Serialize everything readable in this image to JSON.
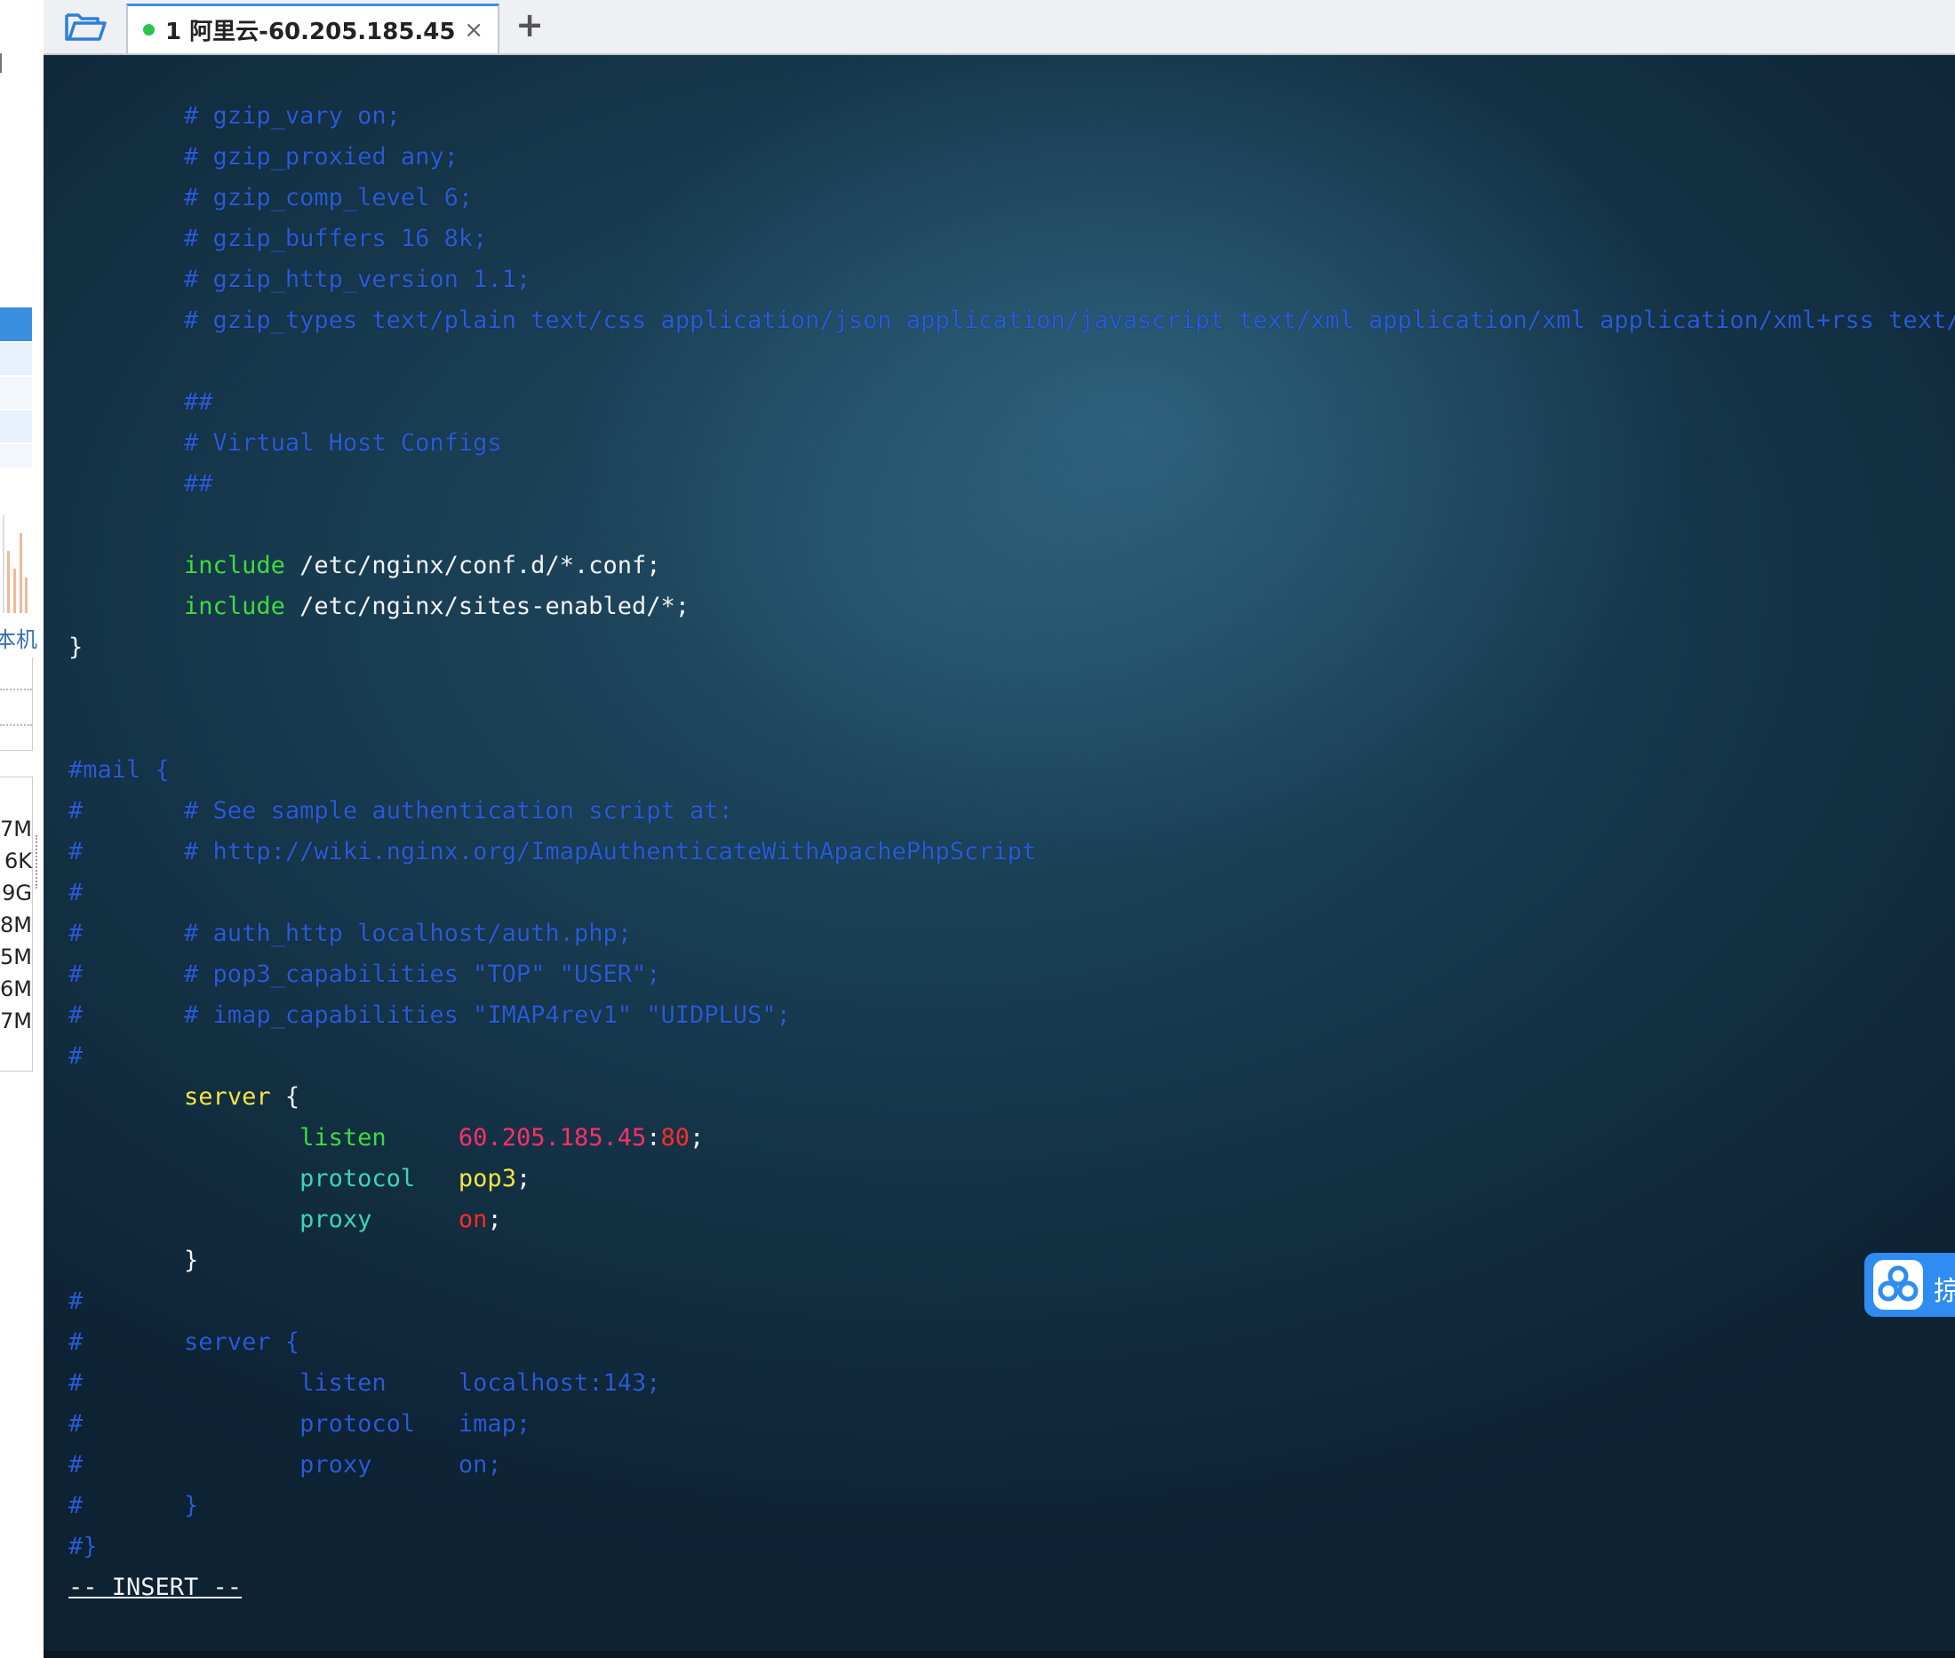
{
  "left_panel": {
    "label": "本机",
    "sizes": [
      "7M",
      "6K",
      "9G",
      "8M",
      "5M",
      "6M",
      "7M"
    ]
  },
  "tabbar": {
    "folder_icon": "folder-open-icon",
    "tab_number": "1",
    "tab_title": "阿里云-60.205.185.45",
    "close_glyph": "×",
    "new_tab_glyph": "+"
  },
  "terminal": {
    "lines": [
      {
        "segments": [
          {
            "text": "        # gzip_vary on;",
            "cls": "c-comment"
          }
        ]
      },
      {
        "segments": [
          {
            "text": "        # gzip_proxied any;",
            "cls": "c-comment"
          }
        ]
      },
      {
        "segments": [
          {
            "text": "        # gzip_comp_level 6;",
            "cls": "c-comment"
          }
        ]
      },
      {
        "segments": [
          {
            "text": "        # gzip_buffers 16 8k;",
            "cls": "c-comment"
          }
        ]
      },
      {
        "segments": [
          {
            "text": "        # gzip_http_version 1.1;",
            "cls": "c-comment"
          }
        ]
      },
      {
        "segments": [
          {
            "text": "        # gzip_types text/plain text/css application/json application/javascript text/xml application/xml application/xml+rss text/javascript;",
            "cls": "c-comment"
          }
        ]
      },
      {
        "segments": []
      },
      {
        "segments": [
          {
            "text": "        ##",
            "cls": "c-comment"
          }
        ]
      },
      {
        "segments": [
          {
            "text": "        # Virtual Host Configs",
            "cls": "c-comment"
          }
        ]
      },
      {
        "segments": [
          {
            "text": "        ##",
            "cls": "c-comment"
          }
        ]
      },
      {
        "segments": []
      },
      {
        "segments": [
          {
            "text": "        ",
            "cls": "c-white"
          },
          {
            "text": "include",
            "cls": "c-green"
          },
          {
            "text": " /etc/nginx/conf.d/*.conf;",
            "cls": "c-white"
          }
        ]
      },
      {
        "segments": [
          {
            "text": "        ",
            "cls": "c-white"
          },
          {
            "text": "include",
            "cls": "c-green"
          },
          {
            "text": " /etc/nginx/sites-enabled/*;",
            "cls": "c-white"
          }
        ]
      },
      {
        "segments": [
          {
            "text": "}",
            "cls": "c-white"
          }
        ]
      },
      {
        "segments": []
      },
      {
        "segments": []
      },
      {
        "segments": [
          {
            "text": "#mail {",
            "cls": "c-comment"
          }
        ]
      },
      {
        "segments": [
          {
            "text": "#       # See sample authentication script at:",
            "cls": "c-comment"
          }
        ]
      },
      {
        "segments": [
          {
            "text": "#       # http://wiki.nginx.org/ImapAuthenticateWithApachePhpScript",
            "cls": "c-comment"
          }
        ]
      },
      {
        "segments": [
          {
            "text": "#",
            "cls": "c-comment"
          }
        ]
      },
      {
        "segments": [
          {
            "text": "#       # auth_http localhost/auth.php;",
            "cls": "c-comment"
          }
        ]
      },
      {
        "segments": [
          {
            "text": "#       # pop3_capabilities \"TOP\" \"USER\";",
            "cls": "c-comment"
          }
        ]
      },
      {
        "segments": [
          {
            "text": "#       # imap_capabilities \"IMAP4rev1\" \"UIDPLUS\";",
            "cls": "c-comment"
          }
        ]
      },
      {
        "segments": [
          {
            "text": "#",
            "cls": "c-comment"
          }
        ]
      },
      {
        "segments": [
          {
            "text": "        ",
            "cls": "c-white"
          },
          {
            "text": "server",
            "cls": "c-yellow"
          },
          {
            "text": " {",
            "cls": "c-white"
          }
        ]
      },
      {
        "segments": [
          {
            "text": "                ",
            "cls": "c-white"
          },
          {
            "text": "listen",
            "cls": "c-green"
          },
          {
            "text": "     ",
            "cls": "c-white"
          },
          {
            "text": "60.205.185.45",
            "cls": "c-pink"
          },
          {
            "text": ":",
            "cls": "c-white"
          },
          {
            "text": "80",
            "cls": "c-red"
          },
          {
            "text": ";",
            "cls": "c-white"
          }
        ]
      },
      {
        "segments": [
          {
            "text": "                ",
            "cls": "c-white"
          },
          {
            "text": "protocol",
            "cls": "c-teal"
          },
          {
            "text": "   ",
            "cls": "c-white"
          },
          {
            "text": "pop3",
            "cls": "c-yellow"
          },
          {
            "text": ";",
            "cls": "c-white"
          }
        ]
      },
      {
        "segments": [
          {
            "text": "                ",
            "cls": "c-white"
          },
          {
            "text": "proxy",
            "cls": "c-teal"
          },
          {
            "text": "      ",
            "cls": "c-white"
          },
          {
            "text": "on",
            "cls": "c-red"
          },
          {
            "text": ";",
            "cls": "c-white"
          }
        ]
      },
      {
        "segments": [
          {
            "text": "        }",
            "cls": "c-white"
          }
        ]
      },
      {
        "segments": [
          {
            "text": "#",
            "cls": "c-comment"
          }
        ]
      },
      {
        "segments": [
          {
            "text": "#       server {",
            "cls": "c-comment"
          }
        ]
      },
      {
        "segments": [
          {
            "text": "#               listen     localhost:143;",
            "cls": "c-comment"
          }
        ]
      },
      {
        "segments": [
          {
            "text": "#               protocol   imap;",
            "cls": "c-comment"
          }
        ]
      },
      {
        "segments": [
          {
            "text": "#               proxy      on;",
            "cls": "c-comment"
          }
        ]
      },
      {
        "segments": [
          {
            "text": "#       }",
            "cls": "c-comment"
          }
        ]
      },
      {
        "segments": [
          {
            "text": "#}",
            "cls": "c-comment"
          }
        ]
      },
      {
        "segments": [
          {
            "text": "-- INSERT --",
            "cls": "c-mode"
          }
        ]
      }
    ]
  },
  "float_widget": {
    "icon": "cloud-share-icon",
    "text": "掠"
  },
  "colors": {
    "terminal_bg": "#173a50",
    "comment": "#2a5bd6",
    "keyword_green": "#3ddc3d",
    "keyword_yellow": "#f5e442",
    "accent_tab": "#3b8fe0"
  }
}
